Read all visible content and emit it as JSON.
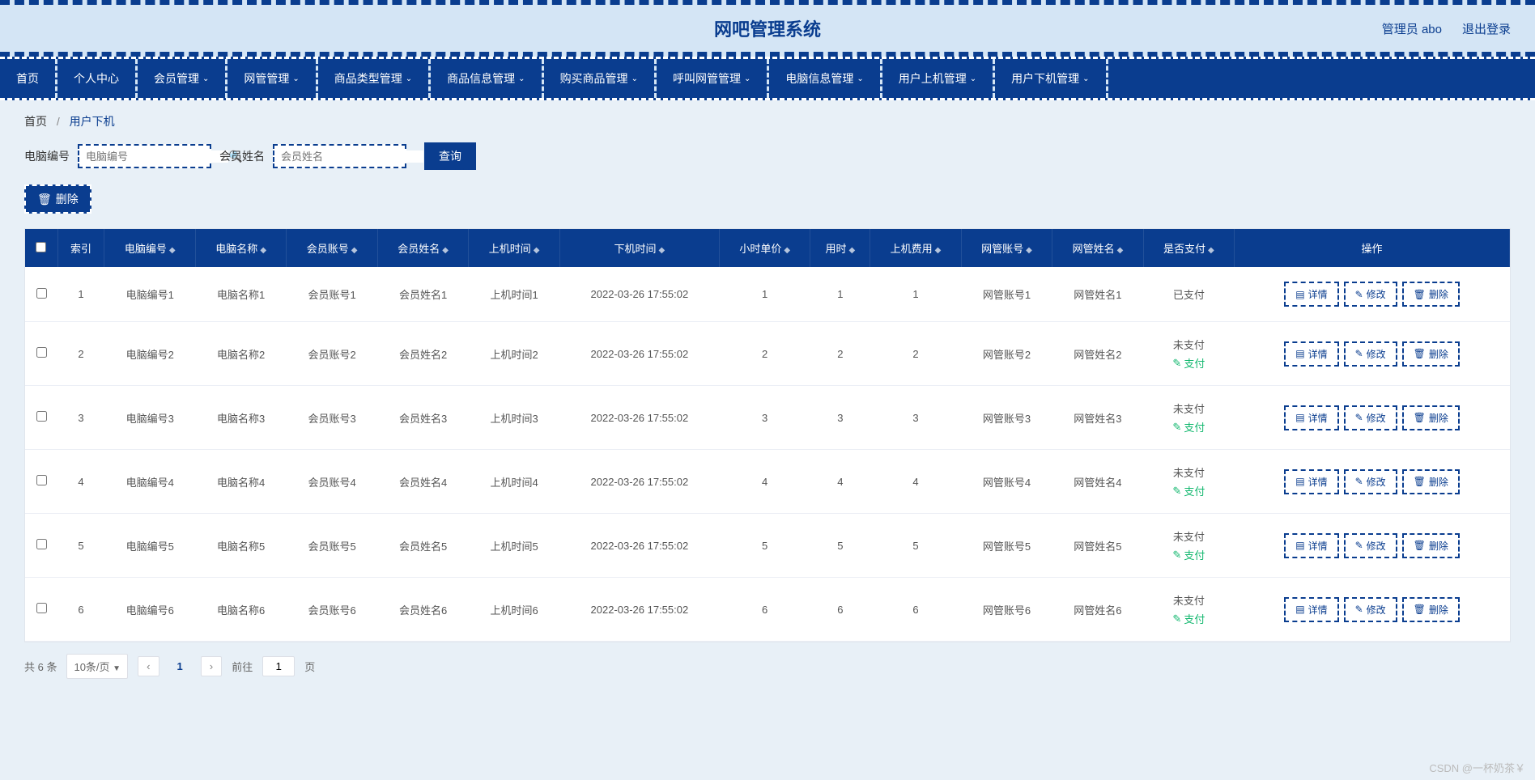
{
  "header": {
    "title": "网吧管理系统",
    "user_label": "管理员 abo",
    "logout_label": "退出登录"
  },
  "nav": {
    "items": [
      {
        "label": "首页",
        "dropdown": false
      },
      {
        "label": "个人中心",
        "dropdown": false
      },
      {
        "label": "会员管理",
        "dropdown": true
      },
      {
        "label": "网管管理",
        "dropdown": true
      },
      {
        "label": "商品类型管理",
        "dropdown": true
      },
      {
        "label": "商品信息管理",
        "dropdown": true
      },
      {
        "label": "购买商品管理",
        "dropdown": true
      },
      {
        "label": "呼叫网管管理",
        "dropdown": true
      },
      {
        "label": "电脑信息管理",
        "dropdown": true
      },
      {
        "label": "用户上机管理",
        "dropdown": true
      },
      {
        "label": "用户下机管理",
        "dropdown": true
      }
    ]
  },
  "breadcrumb": {
    "home": "首页",
    "sep": "/",
    "current": "用户下机"
  },
  "search": {
    "field1_label": "电脑编号",
    "field1_placeholder": "电脑编号",
    "field2_label": "会员姓名",
    "field2_placeholder": "会员姓名",
    "query_label": "查询"
  },
  "toolbar": {
    "delete_label": "删除"
  },
  "table": {
    "headers": [
      "",
      "索引",
      "电脑编号",
      "电脑名称",
      "会员账号",
      "会员姓名",
      "上机时间",
      "下机时间",
      "小时单价",
      "用时",
      "上机费用",
      "网管账号",
      "网管姓名",
      "是否支付",
      "操作"
    ],
    "rows": [
      {
        "idx": "1",
        "pc_no": "电脑编号1",
        "pc_name": "电脑名称1",
        "mem_acc": "会员账号1",
        "mem_name": "会员姓名1",
        "on_time": "上机时间1",
        "off_time": "2022-03-26 17:55:02",
        "price": "1",
        "duration": "1",
        "fee": "1",
        "mgr_acc": "网管账号1",
        "mgr_name": "网管姓名1",
        "paid": true,
        "paid_label": "已支付"
      },
      {
        "idx": "2",
        "pc_no": "电脑编号2",
        "pc_name": "电脑名称2",
        "mem_acc": "会员账号2",
        "mem_name": "会员姓名2",
        "on_time": "上机时间2",
        "off_time": "2022-03-26 17:55:02",
        "price": "2",
        "duration": "2",
        "fee": "2",
        "mgr_acc": "网管账号2",
        "mgr_name": "网管姓名2",
        "paid": false,
        "paid_label": "未支付"
      },
      {
        "idx": "3",
        "pc_no": "电脑编号3",
        "pc_name": "电脑名称3",
        "mem_acc": "会员账号3",
        "mem_name": "会员姓名3",
        "on_time": "上机时间3",
        "off_time": "2022-03-26 17:55:02",
        "price": "3",
        "duration": "3",
        "fee": "3",
        "mgr_acc": "网管账号3",
        "mgr_name": "网管姓名3",
        "paid": false,
        "paid_label": "未支付"
      },
      {
        "idx": "4",
        "pc_no": "电脑编号4",
        "pc_name": "电脑名称4",
        "mem_acc": "会员账号4",
        "mem_name": "会员姓名4",
        "on_time": "上机时间4",
        "off_time": "2022-03-26 17:55:02",
        "price": "4",
        "duration": "4",
        "fee": "4",
        "mgr_acc": "网管账号4",
        "mgr_name": "网管姓名4",
        "paid": false,
        "paid_label": "未支付"
      },
      {
        "idx": "5",
        "pc_no": "电脑编号5",
        "pc_name": "电脑名称5",
        "mem_acc": "会员账号5",
        "mem_name": "会员姓名5",
        "on_time": "上机时间5",
        "off_time": "2022-03-26 17:55:02",
        "price": "5",
        "duration": "5",
        "fee": "5",
        "mgr_acc": "网管账号5",
        "mgr_name": "网管姓名5",
        "paid": false,
        "paid_label": "未支付"
      },
      {
        "idx": "6",
        "pc_no": "电脑编号6",
        "pc_name": "电脑名称6",
        "mem_acc": "会员账号6",
        "mem_name": "会员姓名6",
        "on_time": "上机时间6",
        "off_time": "2022-03-26 17:55:02",
        "price": "6",
        "duration": "6",
        "fee": "6",
        "mgr_acc": "网管账号6",
        "mgr_name": "网管姓名6",
        "paid": false,
        "paid_label": "未支付"
      }
    ],
    "actions": {
      "detail": "详情",
      "edit": "修改",
      "delete": "删除",
      "pay": "支付"
    }
  },
  "pager": {
    "total_label": "共 6 条",
    "page_size_label": "10条/页",
    "current": "1",
    "jump_prefix": "前往",
    "jump_value": "1",
    "jump_suffix": "页"
  },
  "watermark": "CSDN @一杯奶茶￥"
}
